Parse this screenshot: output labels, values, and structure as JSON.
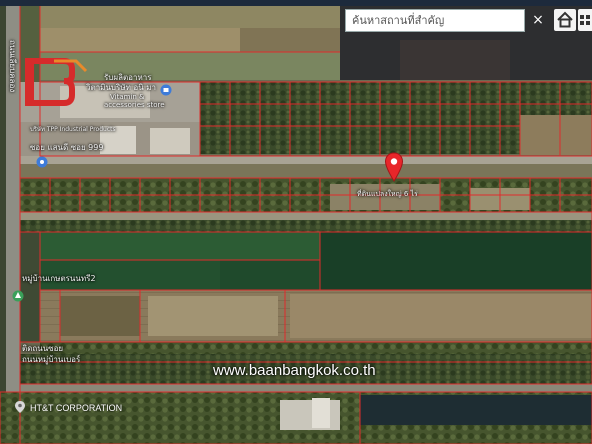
{
  "map": {
    "search": {
      "placeholder": "ค้นหาสถานที่สำคัญ",
      "clear_label": "×"
    },
    "labels": {
      "factory_line1": "รับผลิตอาหาร",
      "factory_line2": "วิตามินบริษัท อนิ มา",
      "factory_line3": "Vitamin &",
      "factory_line4": "accessories store",
      "shop_sign": "บริษัท TPP Industrial Products",
      "road_label": "ซอย แสนดี ซอย 999",
      "parcel_label": "ที่ดินแปลงใหญ่ 6 ไร่",
      "left_road": "ถนนเลียบคลอง",
      "temple": "หมู่บ้านเกษตรนนทรี2",
      "bottom_left_1": "ติดถนนซอย",
      "bottom_left_2": "ถนนหมู่บ้านเบอร์",
      "hutt": "HT&T CORPORATION"
    },
    "watermark": "www.baanbangkok.co.th",
    "colors": {
      "parcel_lines": "#e02b2b",
      "pin": "#e8262a",
      "brand_logo": "#d62b2b"
    },
    "icons": [
      "home-icon",
      "grid-icon",
      "location-pin-icon",
      "place-marker-icon"
    ]
  }
}
